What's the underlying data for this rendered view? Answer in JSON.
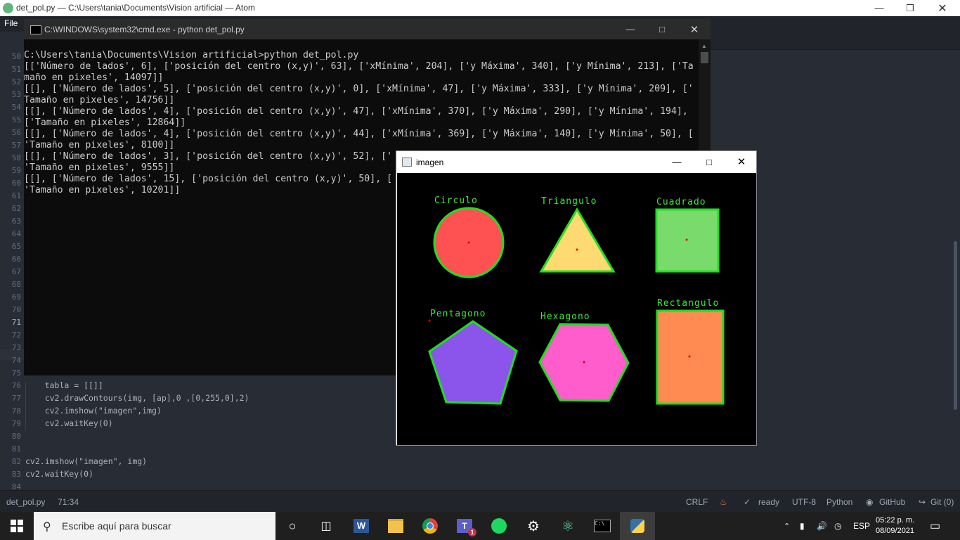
{
  "atom": {
    "title": "det_pol.py — C:\\Users\\tania\\Documents\\Vision artificial — Atom",
    "menu_file": "File",
    "gutter_top": [
      "50",
      "51",
      "52",
      "53",
      "54",
      "55",
      "56",
      "57",
      "58",
      "59",
      "60",
      "61",
      "62",
      "63",
      "64",
      "65",
      "66",
      "67",
      "68",
      "69",
      "70",
      "71",
      "72",
      "73",
      "74"
    ],
    "code_lines": [
      {
        "num": "75",
        "text": ""
      },
      {
        "num": "76",
        "text": "    tabla = [[]]"
      },
      {
        "num": "77",
        "text": "    cv2.drawContours(img, [ap],0 ,[0,255,0],2)"
      },
      {
        "num": "78",
        "text": "    cv2.imshow(\"imagen\",img)"
      },
      {
        "num": "79",
        "text": "    cv2.waitKey(0)"
      },
      {
        "num": "80",
        "text": ""
      },
      {
        "num": "81",
        "text": ""
      },
      {
        "num": "82",
        "text": "cv2.imshow(\"imagen\", img)"
      },
      {
        "num": "83",
        "text": "cv2.waitKey(0)"
      },
      {
        "num": "84",
        "text": ""
      }
    ],
    "status": {
      "file": "det_pol.py",
      "cursor": "71:34",
      "line_ending": "CRLF",
      "ready": "ready",
      "encoding": "UTF-8",
      "grammar": "Python",
      "github": "GitHub",
      "git": "Git (0)"
    }
  },
  "cmd": {
    "title": "C:\\WINDOWS\\system32\\cmd.exe - python  det_pol.py",
    "lines": [
      "C:\\Users\\tania\\Documents\\Vision artificial>python det_pol.py",
      "[['Número de lados', 6], ['posición del centro (x,y)', 63], ['xMínima', 204], ['y Máxima', 340], ['y Mínima', 213], ['Ta",
      "maño en pixeles', 14097]]",
      "[[], ['Número de lados', 5], ['posición del centro (x,y)', 0], ['xMínima', 47], ['y Máxima', 333], ['y Mínima', 209], ['",
      "Tamaño en pixeles', 14756]]",
      "[[], ['Número de lados', 4], ['posición del centro (x,y)', 47], ['xMínima', 370], ['y Máxima', 290], ['y Mínima', 194],",
      "['Tamaño en pixeles', 12864]]",
      "[[], ['Número de lados', 4], ['posición del centro (x,y)', 44], ['xMínima', 369], ['y Máxima', 140], ['y Mínima', 50], [",
      "'Tamaño en pixeles', 8100]]",
      "[[], ['Número de lados', 3], ['posición del centro (x,y)', 52], ['",
      "'Tamaño en pixeles', 9555]]",
      "[[], ['Número de lados', 15], ['posición del centro (x,y)', 50], [",
      "'Tamaño en pixeles', 10201]]"
    ]
  },
  "imagen": {
    "title": "imagen",
    "labels": {
      "circle": "Circulo",
      "triangle": "Triangulo",
      "square": "Cuadrado",
      "pentagon": "Pentagono",
      "hexagon": "Hexagono",
      "rectangle": "Rectangulo"
    },
    "colors": {
      "circle": "#fe5252",
      "triangle": "#ffd971",
      "square": "#79db6b",
      "pentagon": "#8b55ec",
      "hexagon": "#ff5ccc",
      "rectangle": "#ff8a52",
      "contour": "#1ee01e"
    }
  },
  "taskbar": {
    "search_placeholder": "Escribe aquí para buscar",
    "language": "ESP",
    "time": "05:22 p. m.",
    "date": "08/09/2021",
    "teams_badge": "1"
  }
}
